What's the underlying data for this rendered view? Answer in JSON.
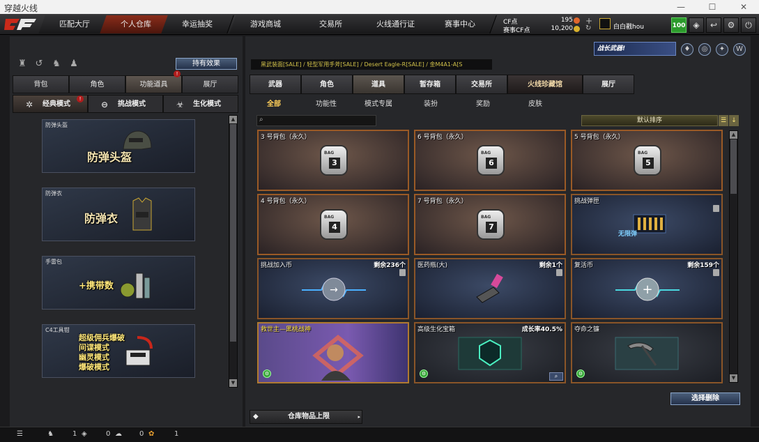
{
  "window": {
    "title": "穿越火线"
  },
  "nav": {
    "tabs": [
      "匹配大厅",
      "个人仓库",
      "幸运抽奖",
      "游戏商城",
      "交易所",
      "火线通行证",
      "赛事中心"
    ],
    "active": 1
  },
  "currency": {
    "cf_label": "CF点",
    "cf_value": "195",
    "event_label": "赛事CF点",
    "event_value": "10,200"
  },
  "user": {
    "name": "白白戳hou",
    "level": "100"
  },
  "promo": {
    "text": "战长武器!"
  },
  "left": {
    "effect_button": "持有效果",
    "tabs": [
      "背包",
      "角色",
      "功能道具",
      "展厅"
    ],
    "active_tab": 2,
    "alert_badge": "!",
    "modes": [
      "经典模式",
      "挑战模式",
      "生化模式"
    ],
    "active_mode": 0,
    "cards": [
      {
        "label": "防弹头盔",
        "big": "防弹头盔"
      },
      {
        "label": "防弹衣",
        "big": "防弹衣"
      },
      {
        "label": "手雷包",
        "big": "+携带数"
      },
      {
        "label": "C4工具钳",
        "big1": "超级佣兵爆破",
        "big2": "间谍模式",
        "big3": "幽灵模式",
        "big4": "爆破模式"
      }
    ]
  },
  "right": {
    "breadcrumb": "黑武装面[SALE] / 轻型军用手斧[SALE] / Desert Eagle-R[SALE] / 金M4A1-A[S",
    "tabs": [
      "武器",
      "角色",
      "道具",
      "暂存箱",
      "交易所",
      "火线珍藏馆",
      "展厅"
    ],
    "active_tab": 2,
    "categories": [
      "全部",
      "功能性",
      "模式专属",
      "装扮",
      "奖励",
      "皮肤"
    ],
    "active_category": 0,
    "search": {
      "value": "",
      "placeholder": ""
    },
    "sort": "默认排序",
    "items": [
      {
        "name": "3 号背包（永久）",
        "right": "",
        "bag": "3"
      },
      {
        "name": "6 号背包（永久）",
        "right": "",
        "bag": "6"
      },
      {
        "name": "5 号背包（永久）",
        "right": "",
        "bag": "5"
      },
      {
        "name": "4 号背包（永久）",
        "right": "",
        "bag": "4"
      },
      {
        "name": "7 号背包（永久）",
        "right": "",
        "bag": "7"
      },
      {
        "name": "挑战弹匣",
        "right": "",
        "extra": "无限弹"
      },
      {
        "name": "挑战加入币",
        "right": "剩余236个"
      },
      {
        "name": "医药瓶(大)",
        "right": "剩余1个"
      },
      {
        "name": "复活币",
        "right": "剩余159个"
      },
      {
        "name": "救世主—黑桃战神",
        "right": ""
      },
      {
        "name": "高级生化宝箱",
        "right": "成长率40.5%"
      },
      {
        "name": "夺命之镰",
        "right": ""
      }
    ],
    "select_delete": "选择删除",
    "capacity_label": "仓库物品上限"
  },
  "bottom": {
    "c1": "1",
    "c2": "0",
    "c3": "0",
    "c4": "1"
  },
  "colors": {
    "accent_red": "#8a2c1a",
    "gold_text": "#ffcf5a",
    "card_border": "#9a5a26"
  }
}
